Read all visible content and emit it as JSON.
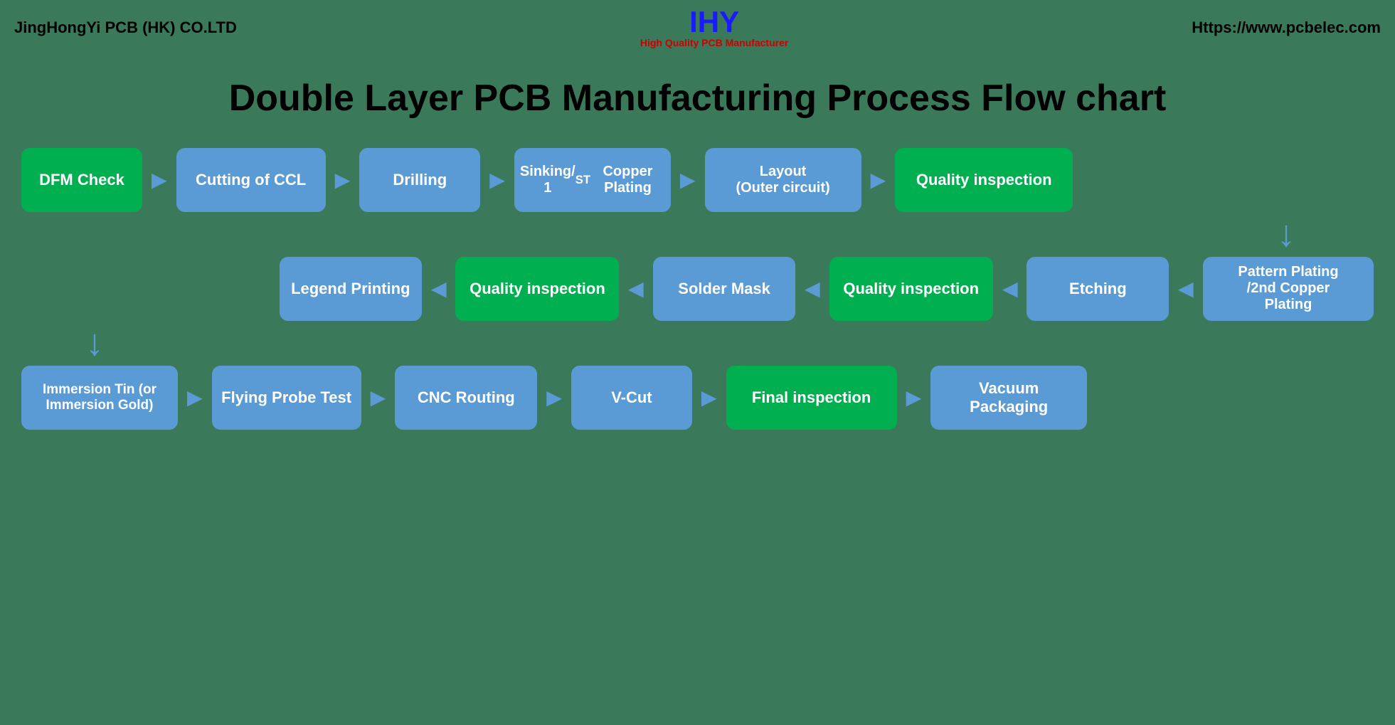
{
  "header": {
    "company": "JingHongYi PCB (HK) CO.LTD",
    "logo_main": "IHY",
    "logo_sub": "High Quality PCB Manufacturer",
    "website": "Https://www.pcbelec.com"
  },
  "title": "Double Layer PCB Manufacturing Process Flow chart",
  "row1": [
    {
      "id": "dfm-check",
      "label": "DFM Check",
      "type": "green"
    },
    {
      "id": "cutting-ccl",
      "label": "Cutting of CCL",
      "type": "blue"
    },
    {
      "id": "drilling",
      "label": "Drilling",
      "type": "blue"
    },
    {
      "id": "sinking-copper",
      "label": "Sinking/\n1ST Copper Plating",
      "type": "blue"
    },
    {
      "id": "layout-outer",
      "label": "Layout\n(Outer circuit)",
      "type": "blue"
    },
    {
      "id": "quality-insp-1",
      "label": "Quality inspection",
      "type": "green"
    }
  ],
  "row2": [
    {
      "id": "legend-printing",
      "label": "Legend Printing",
      "type": "blue"
    },
    {
      "id": "quality-insp-2",
      "label": "Quality inspection",
      "type": "green"
    },
    {
      "id": "solder-mask",
      "label": "Solder Mask",
      "type": "blue"
    },
    {
      "id": "quality-insp-3",
      "label": "Quality inspection",
      "type": "green"
    },
    {
      "id": "etching",
      "label": "Etching",
      "type": "blue"
    },
    {
      "id": "pattern-plating",
      "label": "Pattern Plating\n/2nd Copper\nPlating",
      "type": "blue"
    }
  ],
  "row3": [
    {
      "id": "immersion-tin",
      "label": "Immersion Tin (or\nImmersion Gold)",
      "type": "blue"
    },
    {
      "id": "flying-probe",
      "label": "Flying Probe Test",
      "type": "blue"
    },
    {
      "id": "cnc-routing",
      "label": "CNC Routing",
      "type": "blue"
    },
    {
      "id": "v-cut",
      "label": "V-Cut",
      "type": "blue"
    },
    {
      "id": "final-inspection",
      "label": "Final inspection",
      "type": "green"
    },
    {
      "id": "vacuum-packaging",
      "label": "Vacuum\nPackaging",
      "type": "blue"
    }
  ],
  "arrows": {
    "right": "➤",
    "left": "➤",
    "down": "↓"
  }
}
